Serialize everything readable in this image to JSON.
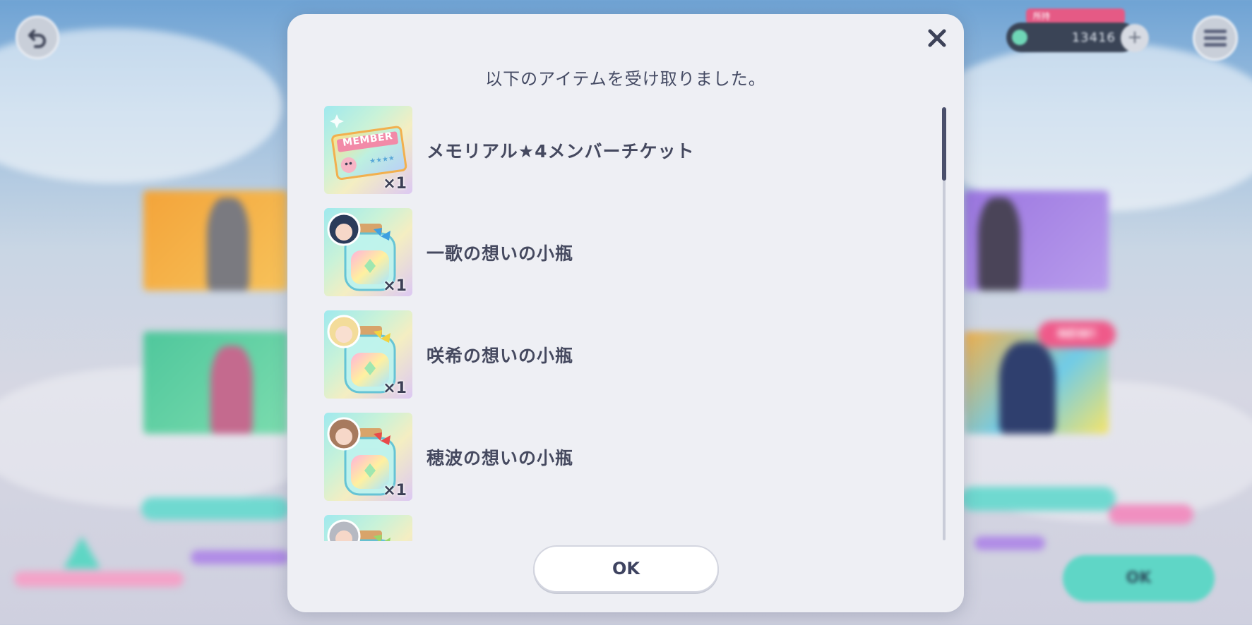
{
  "background": {
    "crystal_count": "13416",
    "crystal_tag": "所持",
    "bg_ok_label": "OK",
    "new_badge": "NEW!"
  },
  "modal": {
    "title": "以下のアイテムを受け取りました。",
    "ok_label": "OK",
    "items": [
      {
        "label": "メモリアル★4メンバーチケット",
        "qty": "×1",
        "icon": "member-ticket-icon",
        "accent": "#f7a0b4"
      },
      {
        "label": "一歌の想いの小瓶",
        "qty": "×1",
        "icon": "bottle-icon",
        "accent": "#3fa0e0"
      },
      {
        "label": "咲希の想いの小瓶",
        "qty": "×1",
        "icon": "bottle-icon",
        "accent": "#f2d340"
      },
      {
        "label": "穂波の想いの小瓶",
        "qty": "×1",
        "icon": "bottle-icon",
        "accent": "#e84a4a"
      },
      {
        "label": "",
        "qty": "",
        "icon": "bottle-icon",
        "accent": "#9ad86a"
      }
    ],
    "ticket_text": "MEMBER"
  },
  "colors": {
    "modal_bg": "#eeeff4",
    "text": "#45495f",
    "accent_teal": "#5fd6c6"
  }
}
